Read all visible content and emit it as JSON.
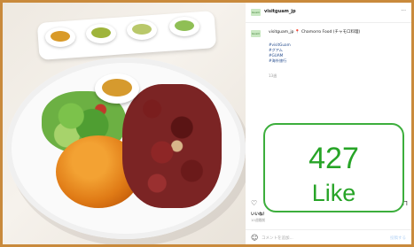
{
  "post": {
    "username": "visitguam_jp",
    "avatar_text": "Guam",
    "caption_line": "visitguam_jp 📍 Chamorro Food (チャモロ料理)",
    "hashtags": [
      "#visitGuam",
      "#グアム",
      "#GUAM",
      "#海外旅行"
    ],
    "time_ago": "13週",
    "likes_text": "いいね！",
    "date_text": "10週間前",
    "comment_placeholder": "コメントを追加...",
    "post_button": "投稿する",
    "icons": {
      "more": "more-dots-icon",
      "like": "heart-icon",
      "save": "bookmark-icon",
      "emoji": "emoji-icon"
    }
  },
  "overlay": {
    "count": "427",
    "label": "Like",
    "color": "#27a427"
  }
}
